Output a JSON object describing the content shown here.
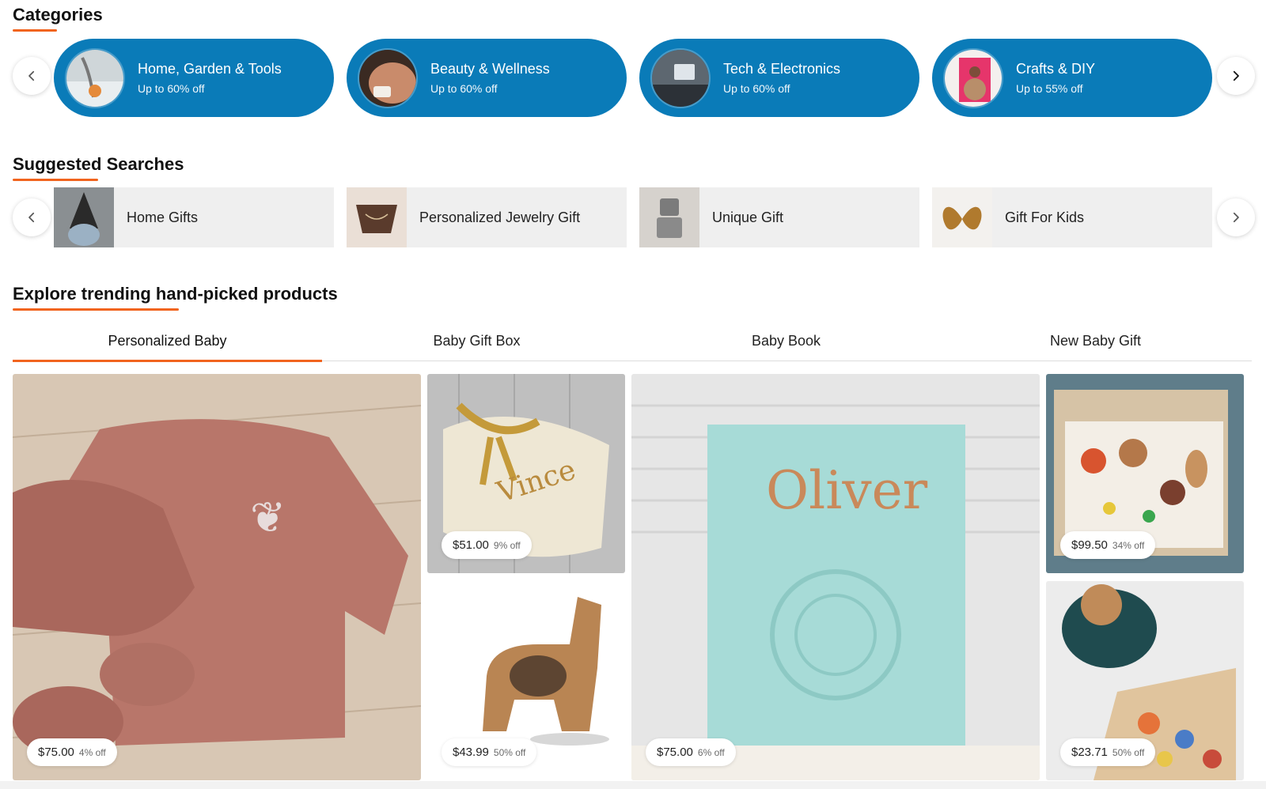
{
  "categories": {
    "title": "Categories",
    "prev_icon": "chevron-left-icon",
    "next_icon": "chevron-right-icon",
    "accent": "#0a7bb8",
    "items": [
      {
        "name": "Home, Garden & Tools",
        "deal": "Up to 60% off"
      },
      {
        "name": "Beauty & Wellness",
        "deal": "Up to 60% off"
      },
      {
        "name": "Tech & Electronics",
        "deal": "Up to 60% off"
      },
      {
        "name": "Crafts & DIY",
        "deal": "Up to 55% off"
      }
    ]
  },
  "suggested": {
    "title": "Suggested Searches",
    "items": [
      {
        "label": "Home Gifts"
      },
      {
        "label": "Personalized Jewelry Gift"
      },
      {
        "label": "Unique Gift"
      },
      {
        "label": "Gift For Kids"
      }
    ]
  },
  "trending": {
    "title": "Explore trending hand-picked products",
    "accent": "#f1641e",
    "tabs": [
      {
        "label": "Personalized Baby",
        "active": true
      },
      {
        "label": "Baby Gift Box",
        "active": false
      },
      {
        "label": "Baby Book",
        "active": false
      },
      {
        "label": "New Baby Gift",
        "active": false
      }
    ],
    "products": [
      {
        "price": "$75.00",
        "off": "4% off"
      },
      {
        "price": "$51.00",
        "off": "9% off"
      },
      {
        "price": "$43.99",
        "off": "50% off"
      },
      {
        "price": "$75.00",
        "off": "6% off"
      },
      {
        "price": "$99.50",
        "off": "34% off"
      },
      {
        "price": "$23.71",
        "off": "50% off"
      }
    ]
  }
}
